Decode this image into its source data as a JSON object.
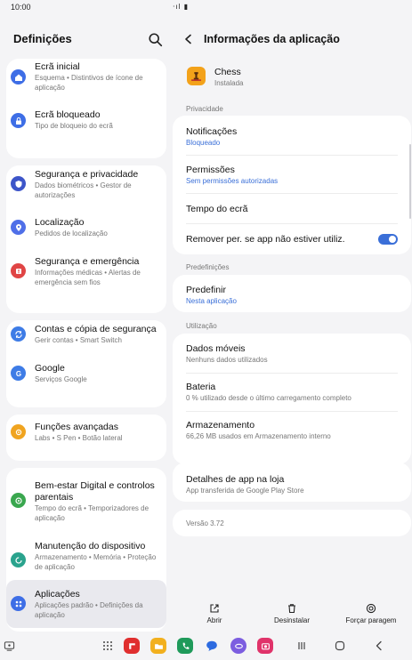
{
  "status": {
    "time": "10:00",
    "right": "‧ıl ▮"
  },
  "left": {
    "title": "Definições",
    "items": [
      {
        "title": "Ecrã inicial",
        "sub": "Esquema  •  Distintivos de ícone de aplicação",
        "color": "#3e6ee6"
      },
      {
        "title": "Ecrã bloqueado",
        "sub": "Tipo de bloqueio do ecrã",
        "color": "#3e6ee6"
      },
      {
        "title": "Segurança e privacidade",
        "sub": "Dados biométricos  •  Gestor de autorizações",
        "color": "#3d55c9"
      },
      {
        "title": "Localização",
        "sub": "Pedidos de localização",
        "color": "#4f6fe8"
      },
      {
        "title": "Segurança e emergência",
        "sub": "Informações médicas  •  Alertas de emergência sem fios",
        "color": "#e04545"
      },
      {
        "title": "Contas e cópia de segurança",
        "sub": "Gerir contas  •  Smart Switch",
        "color": "#3e7ce6"
      },
      {
        "title": "Google",
        "sub": "Serviços Google",
        "color": "#3e7ce6"
      },
      {
        "title": "Funções avançadas",
        "sub": "Labs  •  S Pen  •  Botão lateral",
        "color": "#f0a420"
      },
      {
        "title": "Bem-estar Digital e controlos parentais",
        "sub": "Tempo do ecrã  •  Temporizadores de aplicação",
        "color": "#3aa74f"
      },
      {
        "title": "Manutenção do dispositivo",
        "sub": "Armazenamento  •  Memória  •  Proteção de aplicação",
        "color": "#2aa38d"
      },
      {
        "title": "Aplicações",
        "sub": "Aplicações padrão  •  Definições da aplicação",
        "color": "#3e6ee6"
      }
    ]
  },
  "right": {
    "title": "Informações da aplicação",
    "app_name": "Chess",
    "app_status": "Instalada",
    "privacy_label": "Privacidade",
    "notif_title": "Notificações",
    "notif_sub": "Bloqueado",
    "perm_title": "Permissões",
    "perm_sub": "Sem permissões autorizadas",
    "screen_title": "Tempo do ecrã",
    "remove_title": "Remover per. se app não estiver utiliz.",
    "defaults_label": "Predefinições",
    "default_title": "Predefinir",
    "default_sub": "Nesta aplicação",
    "usage_label": "Utilização",
    "mobile_title": "Dados móveis",
    "mobile_sub": "Nenhuns dados utilizados",
    "battery_title": "Bateria",
    "battery_sub": "0 % utilizado desde o último carregamento completo",
    "storage_title": "Armazenamento",
    "storage_sub": "66,26 MB usados em Armazenamento interno",
    "store_title": "Detalhes de app na loja",
    "store_sub": "App transferida de Google Play Store",
    "version": "Versão 3.72"
  },
  "actions": {
    "open": "Abrir",
    "uninstall": "Desinstalar",
    "force_stop": "Forçar paragem"
  },
  "colors": {
    "accent": "#3a6fd8"
  }
}
